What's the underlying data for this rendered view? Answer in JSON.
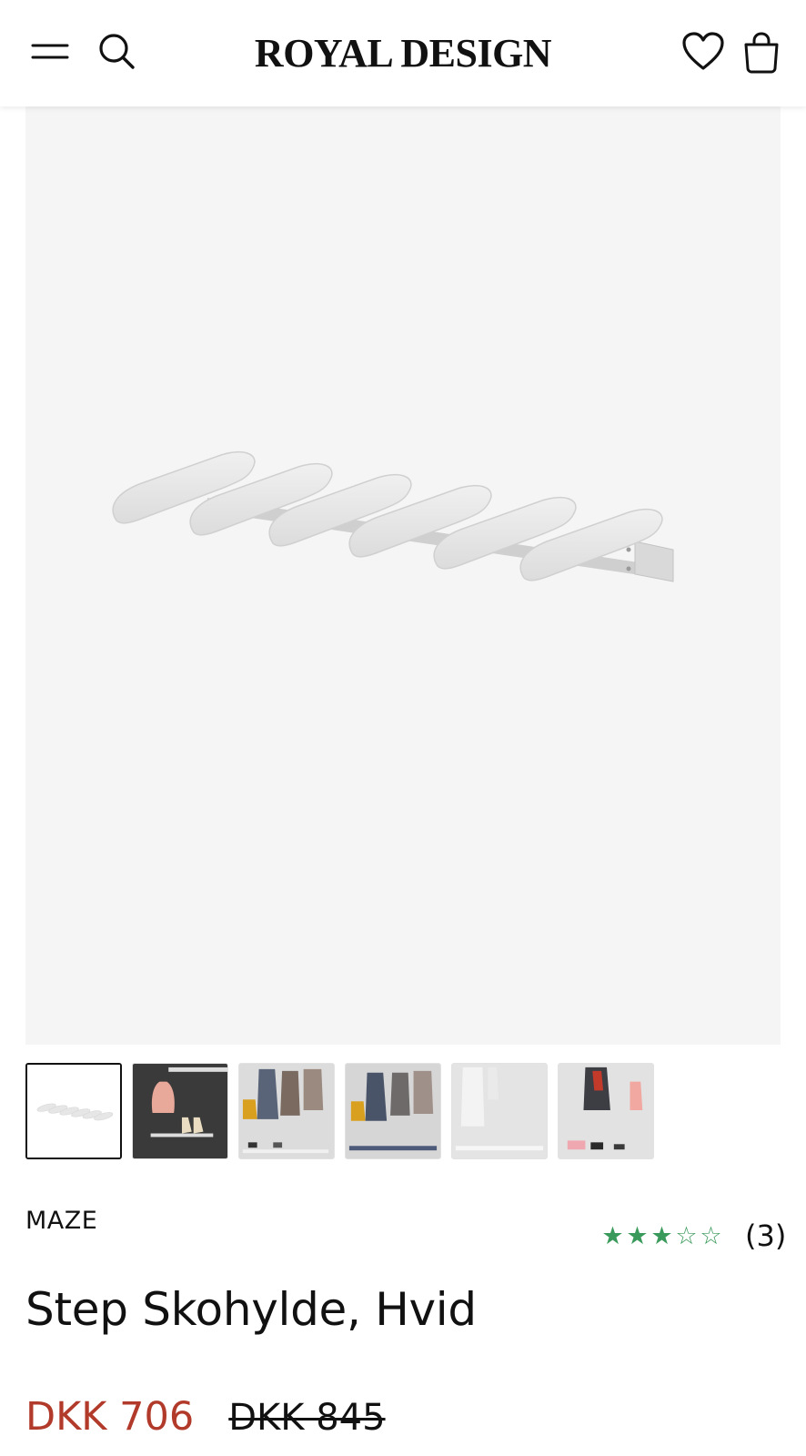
{
  "header": {
    "logo": "ROYAL DESIGN",
    "icons": [
      "menu-icon",
      "search-icon",
      "heart-icon",
      "bag-icon"
    ]
  },
  "gallery": {
    "thumbnails": [
      {
        "label": "product-white"
      },
      {
        "label": "lifestyle-pink-bag"
      },
      {
        "label": "lifestyle-hallway-1"
      },
      {
        "label": "lifestyle-hallway-2"
      },
      {
        "label": "lifestyle-white-wall"
      },
      {
        "label": "lifestyle-coat-pink"
      }
    ],
    "active_index": 0
  },
  "product": {
    "brand": "MAZE",
    "title": "Step Skohylde, Hvid",
    "rating": {
      "stars": 3,
      "max": 5,
      "count": "(3)"
    },
    "price": {
      "sale": "DKK 706",
      "original": "DKK 845"
    }
  },
  "colors": {
    "sale_price": "#b23a2a",
    "star": "#3a9a5b",
    "hero_bg": "#f5f5f5"
  }
}
